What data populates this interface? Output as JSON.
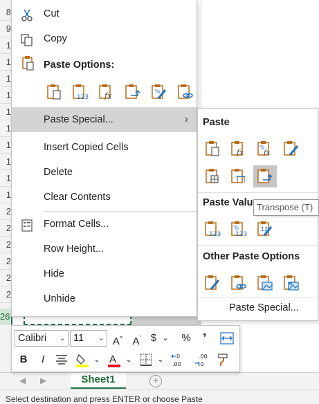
{
  "row_headers": [
    "8",
    "9",
    "1",
    "1",
    "1",
    "1",
    "1",
    "1",
    "1",
    "1",
    "1",
    "1",
    "2",
    "2",
    "2",
    "2",
    "2",
    "2",
    "26"
  ],
  "context_menu": {
    "cut": {
      "label": "Cut",
      "icon": "scissors-icon"
    },
    "copy": {
      "label": "Copy",
      "icon": "copy-icon"
    },
    "paste_options_title": "Paste Options:",
    "paste_options_icons": [
      "paste-icon",
      "paste-values-icon",
      "paste-formulas-icon",
      "paste-transpose-icon",
      "paste-formatting-icon",
      "paste-link-icon"
    ],
    "paste_special": {
      "label": "Paste Special...",
      "arrow": "›"
    },
    "insert_copied_cells": "Insert Copied Cells",
    "delete": "Delete",
    "clear_contents": "Clear Contents",
    "format_cells": {
      "label": "Format Cells...",
      "icon": "format-cells-icon"
    },
    "row_height": "Row Height...",
    "hide": "Hide",
    "unhide": "Unhide"
  },
  "paste_special_submenu": {
    "paste_title": "Paste",
    "paste_values_title": "Paste Values",
    "other_title": "Other Paste Options",
    "footer_link": "Paste Special...",
    "tooltip": "Transpose (T)"
  },
  "mini_toolbar": {
    "font_name": "Calibri",
    "font_size": "11",
    "bold": "B",
    "italic": "I",
    "percent": "%",
    "comma": "❜",
    "currency": "$"
  },
  "sheet_tab": "Sheet1",
  "status_text": "Select destination and press ENTER or choose Paste",
  "colors": {
    "excel_green": "#217346",
    "highlight": "#d4d4d4",
    "fill_yellow": "#ffff00",
    "font_red": "#e81123"
  }
}
